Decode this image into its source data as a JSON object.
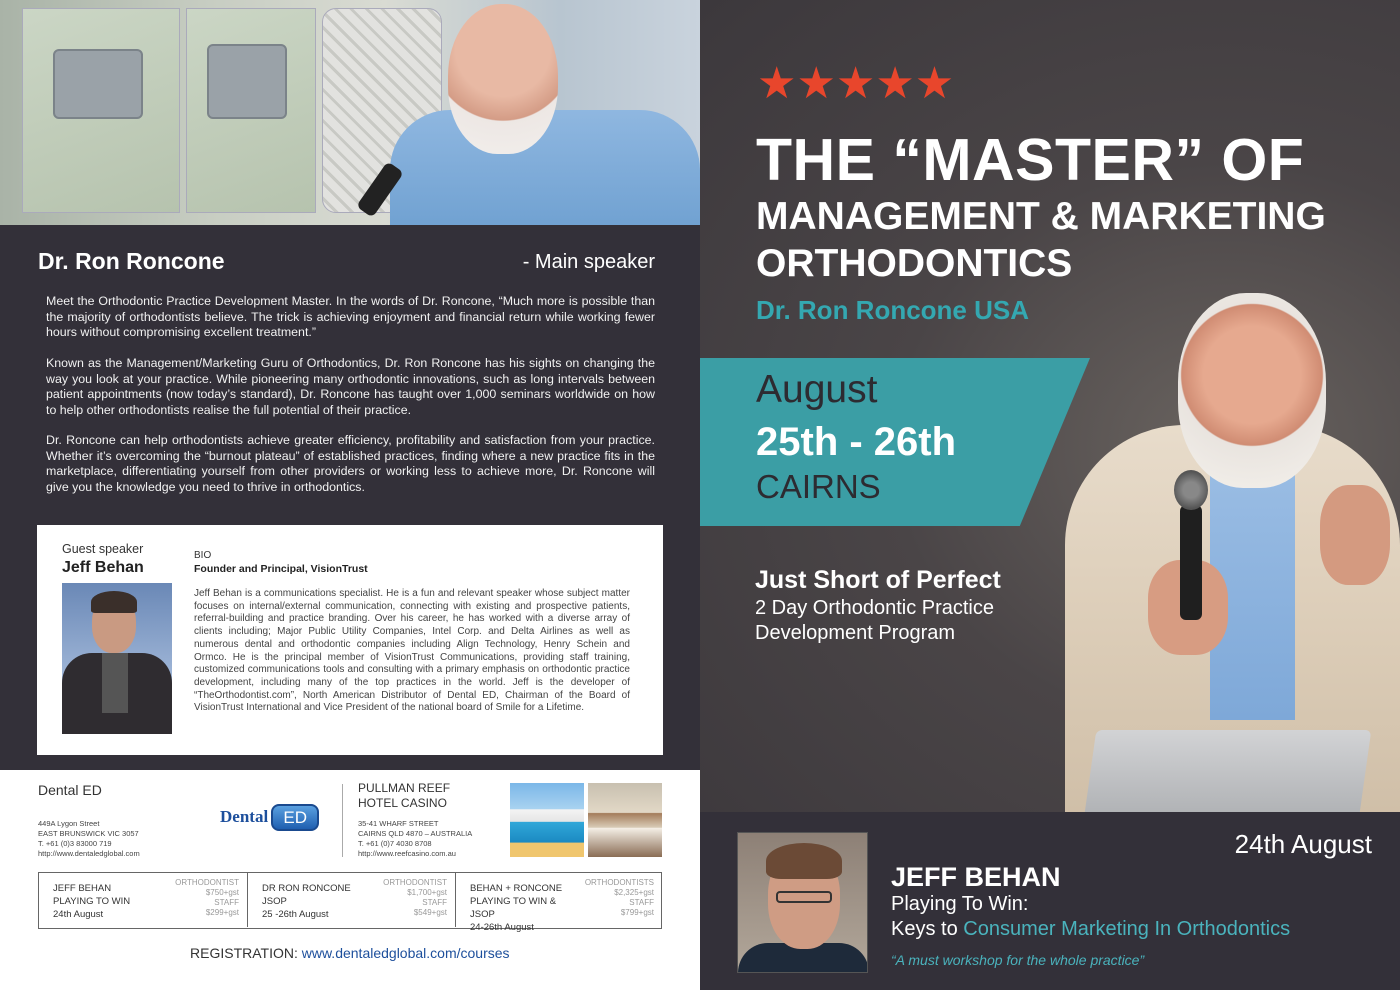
{
  "left": {
    "speaker_name": "Dr. Ron Roncone",
    "speaker_role": "- Main speaker",
    "paragraphs": [
      "Meet the Orthodontic Practice Development Master. In the words of Dr. Roncone, “Much more is possible than the majority of orthodontists believe. The trick is achieving enjoyment and financial return while working fewer hours without compromising excellent treatment.”",
      "Known as the Management/Marketing Guru of Orthodontics, Dr. Ron Roncone has his sights on changing the way you look at your practice. While pioneering many orthodontic innovations, such as long intervals between patient appointments (now today’s standard), Dr. Roncone has taught over 1,000 seminars worldwide on how to help other orthodontists realise the full potential of their practice.",
      "Dr. Roncone can help orthodontists achieve greater efficiency, profitability and satisfaction from your practice. Whether it’s overcoming the “burnout plateau” of established practices, finding where a new practice fits in the marketplace, differentiating yourself from other providers or working less to achieve more, Dr. Roncone will give you the knowledge you need to thrive in orthodontics."
    ],
    "guest": {
      "label": "Guest speaker",
      "name": "Jeff Behan",
      "bio_label": "BIO",
      "bio_title": "Founder and Principal, VisionTrust",
      "bio_text": "Jeff Behan is a communications specialist. He is a fun and relevant speaker whose subject matter focuses on internal/external communication, connecting with existing and prospective patients, referral-building and practice branding. Over his career, he has worked with a diverse array of clients including; Major Public Utility Companies, Intel Corp. and Delta Airlines as well as numerous dental and orthodontic companies including Align Technology, Henry Schein and Ormco. He is the principal member of VisionTrust Communications, providing staff training, customized communications tools and consulting with a primary emphasis on orthodontic practice development, including many of the top practices in the world. Jeff is the developer of “TheOrthodontist.com”, North American Distributor of Dental ED, Chairman of the Board of VisionTrust International and Vice President of the national board of Smile for a Lifetime."
    },
    "company": {
      "name": "Dental ED",
      "address": [
        "449A Lygon Street",
        "EAST BRUNSWICK VIC 3057",
        "T. +61 (0)3 83000 719",
        "http://www.dentaledglobal.com"
      ],
      "logo_word": "Dental",
      "logo_box": "ED"
    },
    "hotel": {
      "name": [
        "PULLMAN REEF",
        "HOTEL CASINO"
      ],
      "address": [
        "35-41 WHARF STREET",
        "CAIRNS QLD 4870 – AUSTRALIA",
        "T. +61 (0)7 4030 8708",
        "http://www.reefcasino.com.au"
      ]
    },
    "prices": [
      {
        "title": [
          "JEFF BEHAN",
          "PLAYING TO WIN",
          "24th August"
        ],
        "price": [
          "ORTHODONTIST",
          "$750+gst",
          "STAFF",
          "$299+gst"
        ]
      },
      {
        "title": [
          "DR RON RONCONE",
          "JSOP",
          "25 -26th August"
        ],
        "price": [
          "ORTHODONTIST",
          "$1,700+gst",
          "STAFF",
          "$549+gst"
        ]
      },
      {
        "title": [
          "BEHAN + RONCONE",
          "PLAYING TO WIN & JSOP",
          "24-26th August"
        ],
        "price": [
          "ORTHODONTISTS",
          "$2,325+gst",
          "STAFF",
          "$799+gst"
        ]
      }
    ],
    "registration_label": "REGISTRATION: ",
    "registration_link": "www.dentaledglobal.com/courses"
  },
  "right": {
    "stars": "★★★★★",
    "title": "THE “MASTER” OF",
    "subtitle_1": "MANAGEMENT & MARKETING",
    "subtitle_2": "ORTHODONTICS",
    "presenter": "Dr. Ron Roncone USA",
    "date_month": "August",
    "date_days": "25th - 26th",
    "date_city": "CAIRNS",
    "pitch_title": "Just Short of Perfect",
    "pitch_line_1": "2 Day Orthodontic Practice",
    "pitch_line_2": "Development Program",
    "bottom_date": "24th August",
    "jeff_name": "JEFF BEHAN",
    "jeff_line_1": "Playing To Win:",
    "jeff_line_2_plain": "Keys to ",
    "jeff_line_2_teal": "Consumer Marketing In Orthodontics",
    "jeff_quote": "“A must workshop for the whole practice”"
  },
  "colors": {
    "accent_teal": "#3b9ea5",
    "star_red": "#e8462c",
    "dark_panel": "#333039",
    "brand_blue": "#1d4f9c"
  }
}
